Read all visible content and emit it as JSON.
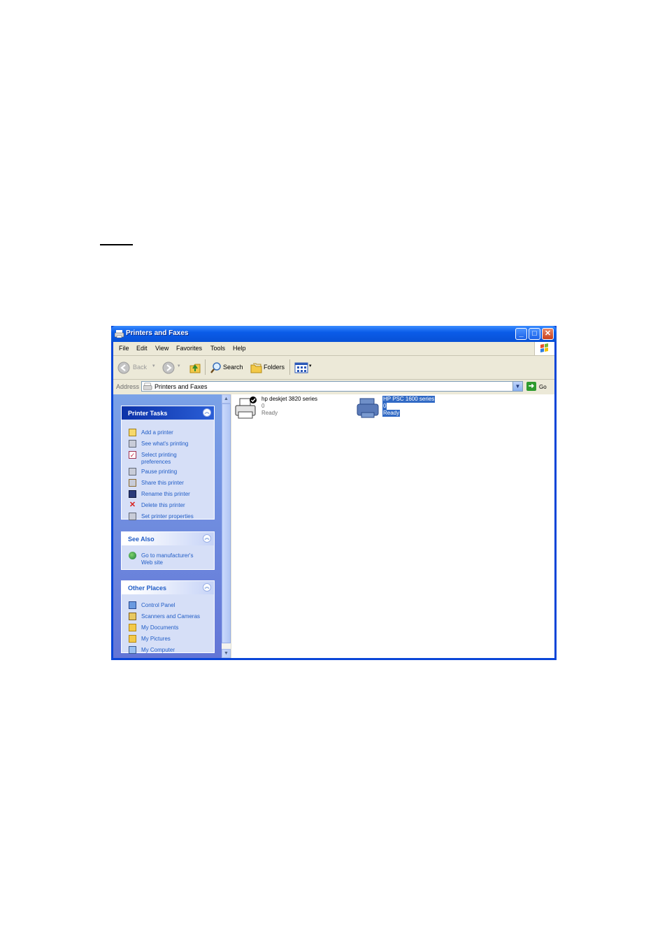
{
  "window": {
    "title": "Printers and Faxes",
    "buttons": {
      "minimize": "_",
      "maximize": "□",
      "close": "✕"
    }
  },
  "menu": [
    "File",
    "Edit",
    "View",
    "Favorites",
    "Tools",
    "Help"
  ],
  "toolbar": {
    "back": "Back",
    "search": "Search",
    "folders": "Folders"
  },
  "address": {
    "label": "Address",
    "value": "Printers and Faxes",
    "go": "Go"
  },
  "panels": {
    "printer_tasks": {
      "title": "Printer Tasks",
      "items": [
        {
          "label": "Add a printer",
          "icon": "add-printer-icon"
        },
        {
          "label": "See what's printing",
          "icon": "printer-queue-icon"
        },
        {
          "label": "Select printing",
          "label2": "preferences",
          "icon": "preferences-icon"
        },
        {
          "label": "Pause printing",
          "icon": "pause-printer-icon"
        },
        {
          "label": "Share this printer",
          "icon": "share-printer-icon"
        },
        {
          "label": "Rename this printer",
          "icon": "rename-icon"
        },
        {
          "label": "Delete this printer",
          "icon": "delete-icon"
        },
        {
          "label": "Set printer properties",
          "icon": "properties-icon"
        }
      ]
    },
    "see_also": {
      "title": "See Also",
      "items": [
        {
          "label": "Go to manufacturer's",
          "label2": "Web site",
          "icon": "globe-icon"
        }
      ]
    },
    "other_places": {
      "title": "Other Places",
      "items": [
        {
          "label": "Control Panel",
          "icon": "control-panel-icon"
        },
        {
          "label": "Scanners and Cameras",
          "icon": "scanner-icon"
        },
        {
          "label": "My Documents",
          "icon": "folder-icon"
        },
        {
          "label": "My Pictures",
          "icon": "pictures-folder-icon"
        },
        {
          "label": "My Computer",
          "icon": "computer-icon"
        }
      ]
    }
  },
  "printers": [
    {
      "name": "hp deskjet 3820 series",
      "jobs": "0",
      "status": "Ready",
      "default": true,
      "selected": false
    },
    {
      "name": "HP PSC 1600 series",
      "jobs": "0",
      "status": "Ready",
      "default": false,
      "selected": true
    }
  ],
  "colors": {
    "titlebar": "#0a5ce8",
    "selection": "#316ac5",
    "task_link": "#215dc6"
  }
}
